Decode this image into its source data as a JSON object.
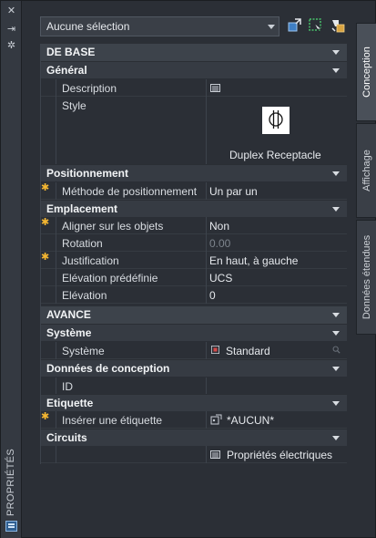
{
  "palette": {
    "title": "PROPRIÉTÉS"
  },
  "toolbar": {
    "selection_value": "Aucune sélection"
  },
  "sections": {
    "base": {
      "title": "DE BASE",
      "general": {
        "title": "Général",
        "description_label": "Description",
        "style_label": "Style",
        "style_name": "Duplex Receptacle"
      },
      "positionnement": {
        "title": "Positionnement",
        "methode_label": "Méthode de positionnement",
        "methode_value": "Un par un"
      },
      "emplacement": {
        "title": "Emplacement",
        "aligner_label": "Aligner sur les objets",
        "aligner_value": "Non",
        "rotation_label": "Rotation",
        "rotation_value": "0.00",
        "justification_label": "Justification",
        "justification_value": "En haut, à gauche",
        "elev_predef_label": "Elévation prédéfinie",
        "elev_predef_value": "UCS",
        "elevation_label": "Elévation",
        "elevation_value": "0"
      }
    },
    "avance": {
      "title": "AVANCE",
      "systeme": {
        "title": "Système",
        "systeme_label": "Système",
        "systeme_value": "Standard"
      },
      "donnees": {
        "title": "Données de conception",
        "id_label": "ID",
        "id_value": ""
      },
      "etiquette": {
        "title": "Etiquette",
        "inserer_label": "Insérer une étiquette",
        "inserer_value": "*AUCUN*"
      },
      "circuits": {
        "title": "Circuits",
        "prop_elec_value": "Propriétés électriques"
      }
    }
  },
  "tabs": [
    "Conception",
    "Affichage",
    "Données étendues"
  ],
  "colors": {
    "accent_star": "#f5b731",
    "panel_bg": "#2b2f36"
  }
}
